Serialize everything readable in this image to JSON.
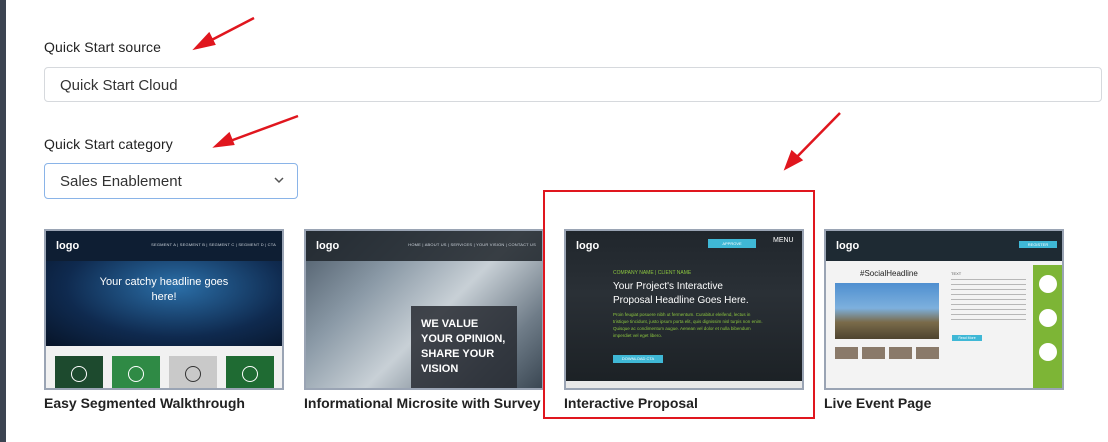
{
  "form": {
    "source_label": "Quick Start source",
    "source_value": "Quick Start Cloud",
    "category_label": "Quick Start category",
    "category_value": "Sales Enablement"
  },
  "templates": [
    {
      "title": "Easy Segmented Walkthrough",
      "thumb": {
        "logo": "logo",
        "nav": "SEGMENT A  |  SEGMENT B  |  SEGMENT C  |  SEGMENT D  |  CTA",
        "headline": "Your catchy headline goes here!"
      }
    },
    {
      "title": "Informational Microsite with Survey",
      "thumb": {
        "logo": "logo",
        "nav": "HOME  |  ABOUT US  |  SERVICES  |  YOUR VISION  |  CONTACT US",
        "headline": "WE VALUE YOUR OPINION, SHARE YOUR VISION"
      }
    },
    {
      "title": "Interactive Proposal",
      "selected": true,
      "thumb": {
        "logo": "logo",
        "button": "APPROVE",
        "menu": "MENU",
        "kicker": "COMPANY NAME | CLIENT NAME",
        "headline": "Your Project's Interactive Proposal Headline Goes Here.",
        "body": "Proin feugiat posuere nibh ut fermentum. Curabitur eleifend, lectus in tristique tincidunt, justo ipsum porta elit, quis dignissim nisl turpis non enim. Quisque ac condimentum augue. Aenean vel dolor et nulla bibendum imperdiet vel eget libero.",
        "cta": "DOWNLOAD CTA"
      }
    },
    {
      "title": "Live Event Page",
      "thumb": {
        "logo": "logo",
        "button": "REGISTER",
        "headline": "#SocialHeadline",
        "text_label": "TEXT",
        "read_more": "Read More"
      }
    }
  ],
  "colors": {
    "accent": "#8ab4e8",
    "highlight": "#e0161e",
    "green": "#1f7a3a"
  }
}
